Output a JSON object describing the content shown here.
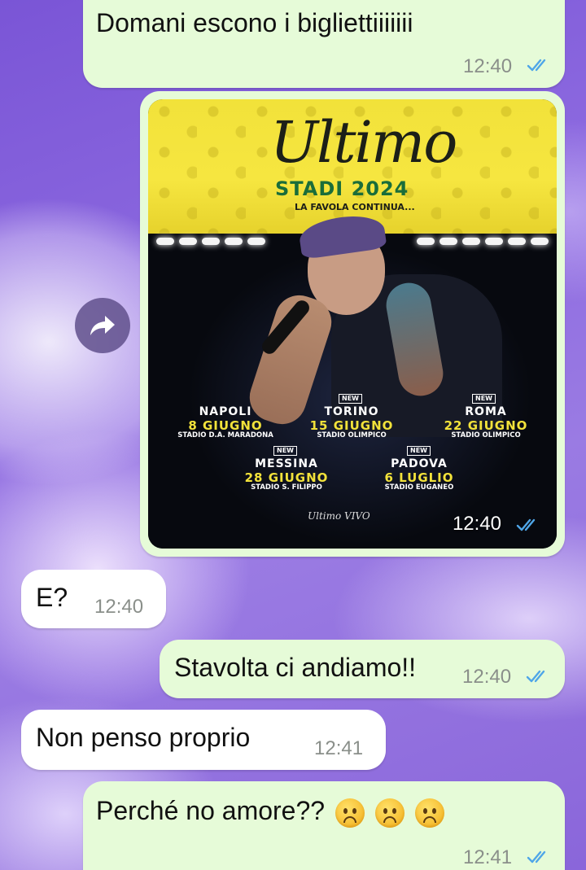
{
  "messages": [
    {
      "text": "Domani escono i bigliettiiiiiii",
      "time": "12:40",
      "direction": "out",
      "status": "read"
    },
    {
      "type": "image",
      "time": "12:40",
      "direction": "out",
      "status": "read"
    },
    {
      "text": "E?",
      "time": "12:40",
      "direction": "in"
    },
    {
      "text": "Stavolta ci andiamo!!",
      "time": "12:40",
      "direction": "out",
      "status": "read"
    },
    {
      "text": "Non penso proprio",
      "time": "12:41",
      "direction": "in"
    },
    {
      "text": "Perché no amore??",
      "emoji": "frowning-face x3",
      "time": "12:41",
      "direction": "out",
      "status": "read"
    }
  ],
  "poster": {
    "logo": "Ultimo",
    "title": "STADI 2024",
    "subtitle": "LA FAVOLA CONTINUA...",
    "new_label": "NEW",
    "dates": [
      {
        "city": "NAPOLI",
        "day": "8 GIUGNO",
        "stadium": "STADIO D.A. MARADONA",
        "new": false
      },
      {
        "city": "TORINO",
        "day": "15 GIUGNO",
        "stadium": "STADIO OLIMPICO",
        "new": true
      },
      {
        "city": "ROMA",
        "day": "22 GIUGNO",
        "stadium": "STADIO OLIMPICO",
        "new": true
      },
      {
        "city": "MESSINA",
        "day": "28 GIUGNO",
        "stadium": "STADIO S. FILIPPO",
        "new": true
      },
      {
        "city": "PADOVA",
        "day": "6 LUGLIO",
        "stadium": "STADIO EUGANEO",
        "new": true
      }
    ],
    "brands": "Ultimo  VIVO"
  },
  "colors": {
    "outgoing_bubble": "#e6fbd8",
    "incoming_bubble": "#ffffff",
    "read_ticks": "#4fa6e8",
    "poster_yellow": "#f2e23a",
    "poster_green": "#1a6d3a"
  },
  "icons": {
    "forward": "forward-arrow-icon",
    "read_status": "double-check-icon"
  }
}
